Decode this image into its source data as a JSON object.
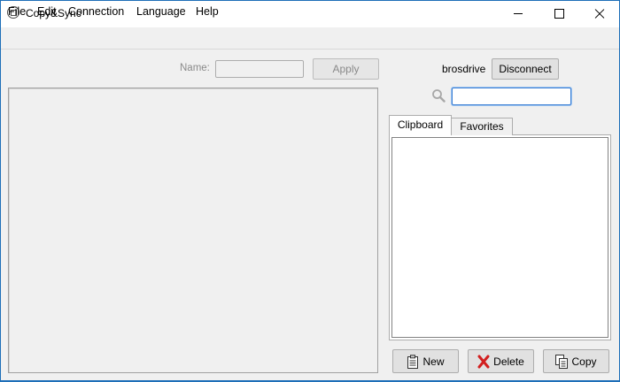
{
  "window": {
    "title": "Copy&Sync",
    "accent_color": "#1e6fb8"
  },
  "menubar": {
    "items": [
      {
        "label": "File"
      },
      {
        "label": "Edit"
      },
      {
        "label": "Connection"
      },
      {
        "label": "Language"
      },
      {
        "label": "Help"
      }
    ]
  },
  "editor": {
    "name_label": "Name:",
    "name_value": "",
    "apply_label": "Apply"
  },
  "account": {
    "username": "brosdrive",
    "disconnect_label": "Disconnect"
  },
  "search": {
    "icon": "search-icon",
    "value": ""
  },
  "tabs": [
    {
      "label": "Clipboard",
      "active": true
    },
    {
      "label": "Favorites",
      "active": false
    }
  ],
  "clipboard_items": [],
  "actions": {
    "new_label": "New",
    "delete_label": "Delete",
    "copy_label": "Copy",
    "new_icon": "clipboard-icon",
    "delete_icon": "red-x-icon",
    "copy_icon": "copy-icon"
  }
}
